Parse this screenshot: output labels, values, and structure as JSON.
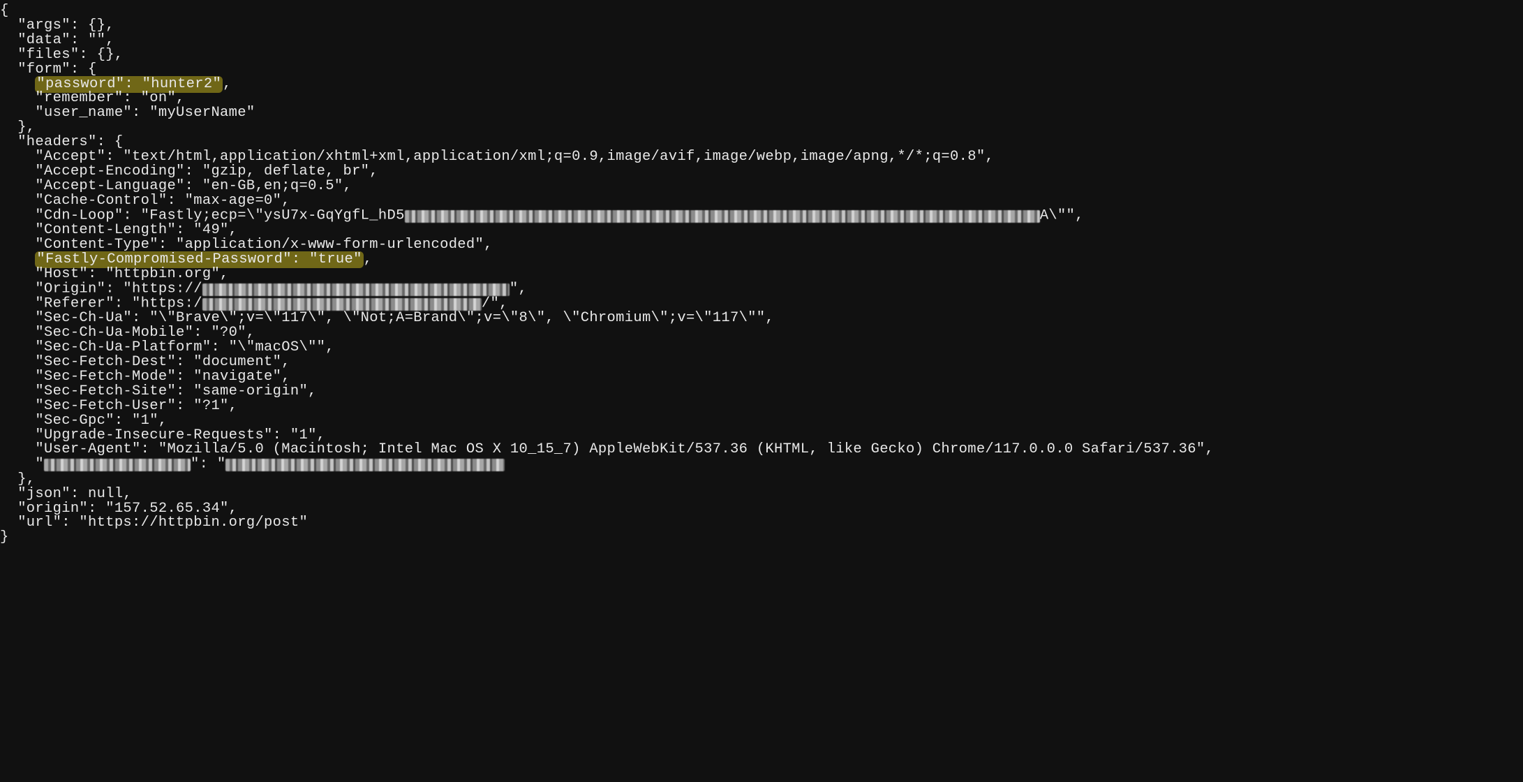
{
  "json": {
    "open_brace": "{",
    "args_line": "  \"args\": {},",
    "data_line": "  \"data\": \"\",",
    "files_line": "  \"files\": {},",
    "form_open": "  \"form\": {",
    "form_password_pair": "\"password\": \"hunter2\"",
    "form_password_trailing": ",",
    "form_remember": "    \"remember\": \"on\",",
    "form_user_name": "    \"user_name\": \"myUserName\"",
    "form_close": "  },",
    "headers_open": "  \"headers\": {",
    "accept": "    \"Accept\": \"text/html,application/xhtml+xml,application/xml;q=0.9,image/avif,image/webp,image/apng,*/*;q=0.8\",",
    "accept_encoding": "    \"Accept-Encoding\": \"gzip, deflate, br\",",
    "accept_language": "    \"Accept-Language\": \"en-GB,en;q=0.5\",",
    "cache_control": "    \"Cache-Control\": \"max-age=0\",",
    "cdn_loop_prefix": "    \"Cdn-Loop\": \"Fastly;ecp=\\\"ysU7x-GqYgfL_hD5",
    "cdn_loop_suffix": "A\\\"\",",
    "content_length": "    \"Content-Length\": \"49\",",
    "content_type": "    \"Content-Type\": \"application/x-www-form-urlencoded\",",
    "fastly_compromised_pair": "\"Fastly-Compromised-Password\": \"true\"",
    "fastly_compromised_trailing": ",",
    "host": "    \"Host\": \"httpbin.org\",",
    "origin_prefix": "    \"Origin\": \"https://",
    "origin_suffix": "\",",
    "referer_prefix": "    \"Referer\": \"https:/",
    "referer_suffix": "/\",",
    "sec_ch_ua": "    \"Sec-Ch-Ua\": \"\\\"Brave\\\";v=\\\"117\\\", \\\"Not;A=Brand\\\";v=\\\"8\\\", \\\"Chromium\\\";v=\\\"117\\\"\",",
    "sec_ch_ua_mobile": "    \"Sec-Ch-Ua-Mobile\": \"?0\",",
    "sec_ch_ua_platform": "    \"Sec-Ch-Ua-Platform\": \"\\\"macOS\\\"\",",
    "sec_fetch_dest": "    \"Sec-Fetch-Dest\": \"document\",",
    "sec_fetch_mode": "    \"Sec-Fetch-Mode\": \"navigate\",",
    "sec_fetch_site": "    \"Sec-Fetch-Site\": \"same-origin\",",
    "sec_fetch_user": "    \"Sec-Fetch-User\": \"?1\",",
    "sec_gpc": "    \"Sec-Gpc\": \"1\",",
    "upgrade_insecure": "    \"Upgrade-Insecure-Requests\": \"1\",",
    "user_agent": "    \"User-Agent\": \"Mozilla/5.0 (Macintosh; Intel Mac OS X 10_15_7) AppleWebKit/537.36 (KHTML, like Gecko) Chrome/117.0.0.0 Safari/537.36\",",
    "redacted_header_indent": "    \"",
    "redacted_header_mid": "\": \"",
    "headers_close": "  },",
    "json_null": "  \"json\": null,",
    "origin_ip": "  \"origin\": \"157.52.65.34\",",
    "url_line": "  \"url\": \"https://httpbin.org/post\"",
    "close_brace": "}",
    "form_password_indent": "    ",
    "header_indent": "    "
  },
  "redact_widths": {
    "cdn_loop": 910,
    "origin": 440,
    "referer": 400,
    "last_header_key": 210,
    "last_header_val": 400
  }
}
